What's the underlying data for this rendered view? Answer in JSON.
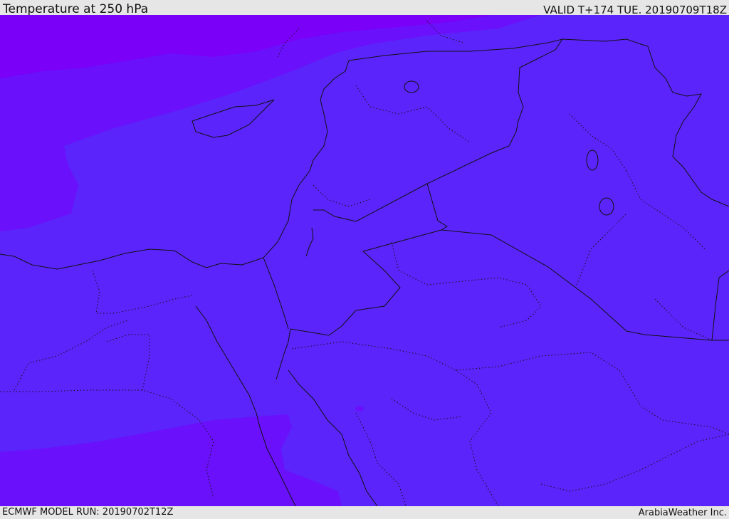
{
  "header": {
    "title": "Temperature at 250 hPa",
    "valid": "VALID T+174 TUE. 20190709T18Z"
  },
  "footer": {
    "model_run": "ECMWF MODEL RUN: 20190702T12Z",
    "credit": "ArabiaWeather Inc."
  },
  "colors": {
    "ui_background": "#e6e6e6",
    "fill_coldest": "#7a00f8",
    "fill_cold": "#6a10fb",
    "fill_base": "#5b24fb",
    "border_line": "#111111"
  }
}
